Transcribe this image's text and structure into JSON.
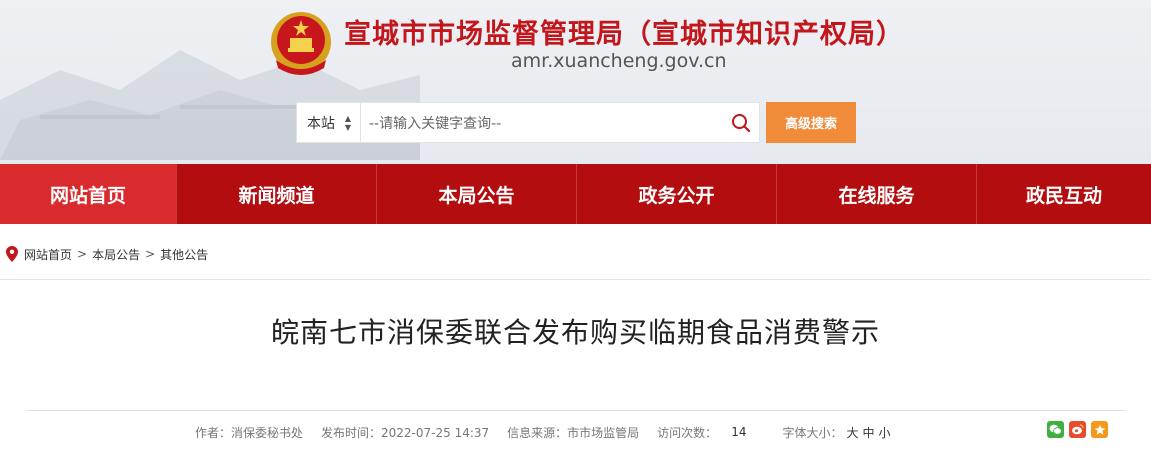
{
  "header": {
    "title": "宣城市市场监督管理局（宣城市知识产权局）",
    "domain": "amr.xuancheng.gov.cn"
  },
  "search": {
    "scope_label": "本站",
    "scope_arrows": "▲▼",
    "placeholder": "--请输入关键字查询--",
    "advanced_label": "高级搜索"
  },
  "nav": {
    "items": [
      {
        "label": "网站首页"
      },
      {
        "label": "新闻频道"
      },
      {
        "label": "本局公告"
      },
      {
        "label": "政务公开"
      },
      {
        "label": "在线服务"
      },
      {
        "label": "政民互动"
      }
    ]
  },
  "breadcrumb": {
    "items": [
      "网站首页",
      "本局公告",
      "其他公告"
    ],
    "separator": ">"
  },
  "article": {
    "title": "皖南七市消保委联合发布购买临期食品消费警示"
  },
  "meta": {
    "author": "作者：消保委秘书处",
    "publish_time": "发布时间：2022-07-25 14:37",
    "source": "信息来源：市市场监管局",
    "visits_label": "访问次数：",
    "visits_count": "14",
    "font_size_label": "字体大小：",
    "font_large": "大",
    "font_medium": "中",
    "font_small": "小"
  },
  "colors": {
    "brand_red": "#c2161a",
    "nav_bg": "#b30d10",
    "nav_active": "#d92a2d",
    "accent_orange": "#f08b3a"
  },
  "icons": [
    "national-emblem-icon",
    "search-icon",
    "location-pin-icon",
    "wechat-icon",
    "weibo-icon",
    "favorite-star-icon"
  ]
}
